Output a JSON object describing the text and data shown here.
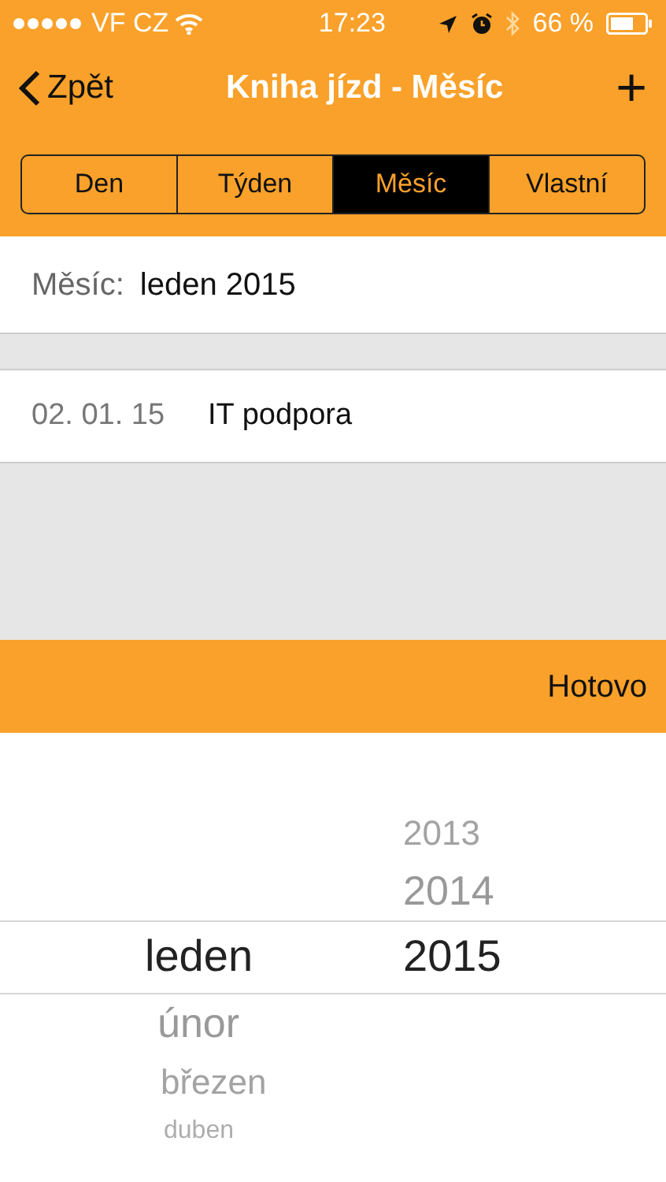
{
  "status_bar": {
    "carrier": "VF CZ",
    "time": "17:23",
    "battery": "66 %"
  },
  "nav": {
    "back": "Zpět",
    "title": "Kniha jízd - Měsíc",
    "add": "+"
  },
  "segments": [
    {
      "label": "Den",
      "selected": false
    },
    {
      "label": "Týden",
      "selected": false
    },
    {
      "label": "Měsíc",
      "selected": true
    },
    {
      "label": "Vlastní",
      "selected": false
    }
  ],
  "month_field": {
    "label": "Měsíc:",
    "value": "leden 2015"
  },
  "entries": [
    {
      "date": "02. 01. 15",
      "name": "IT podpora"
    }
  ],
  "toolbar": {
    "done": "Hotovo"
  },
  "picker": {
    "months": [
      {
        "label": "leden",
        "selected": true
      },
      {
        "label": "únor",
        "selected": false
      },
      {
        "label": "březen",
        "selected": false
      },
      {
        "label": "duben",
        "selected": false
      }
    ],
    "years": [
      {
        "label": "2013",
        "selected": false
      },
      {
        "label": "2014",
        "selected": false
      },
      {
        "label": "2015",
        "selected": true
      }
    ]
  }
}
